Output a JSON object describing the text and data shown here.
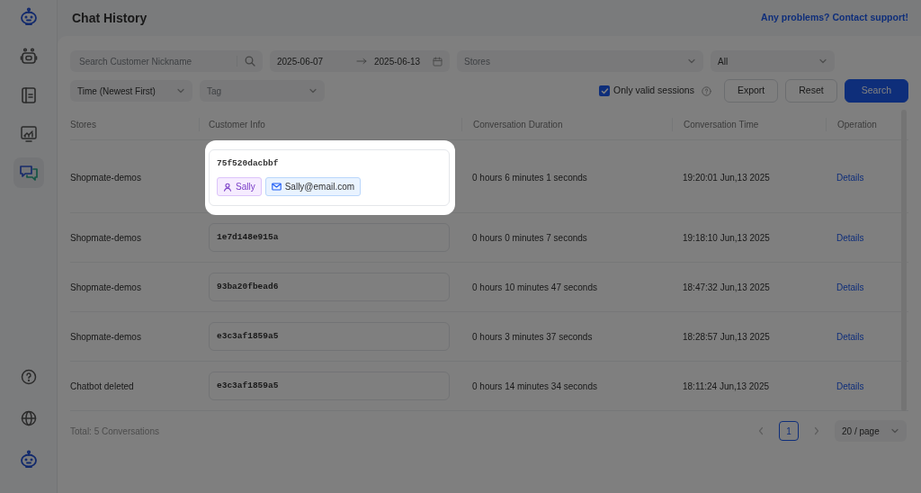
{
  "sidebar": {
    "items": [
      {
        "selected": false
      },
      {
        "selected": false
      },
      {
        "selected": false
      },
      {
        "selected": true
      }
    ]
  },
  "header": {
    "title": "Chat History",
    "support_link": "Any problems? Contact support!"
  },
  "filters": {
    "search": {
      "placeholder": "Search Customer Nickname"
    },
    "date_from": "2025-06-07",
    "date_to": "2025-06-13",
    "stores": {
      "placeholder": "Stores"
    },
    "status": {
      "value": "All"
    },
    "sort": {
      "value": "Time (Newest First)"
    },
    "tag": {
      "placeholder": "Tag"
    },
    "only_valid_sessions": {
      "label": "Only valid sessions",
      "checked": true
    },
    "buttons": [
      {
        "label": "Export",
        "kind": "default"
      },
      {
        "label": "Reset",
        "kind": "default"
      },
      {
        "label": "Search",
        "kind": "primary"
      }
    ]
  },
  "table": {
    "columns": [
      "Stores",
      "Customer Info",
      "Conversation Duration",
      "Conversation Time",
      "Operation"
    ],
    "rows": [
      {
        "store": "Shopmate-demos",
        "customer_id": "75f520dacbbf",
        "highlighted": true,
        "tags": [
          {
            "kind": "name",
            "text": "Sally"
          },
          {
            "kind": "email",
            "text": "Sally@email.com"
          }
        ],
        "duration": "0 hours 6 minutes 1 seconds",
        "time": "19:20:01 Jun,13 2025",
        "action": "Details"
      },
      {
        "store": "Shopmate-demos",
        "customer_id": "1e7d148e915a",
        "highlighted": false,
        "duration": "0 hours 0 minutes 7 seconds",
        "time": "19:18:10 Jun,13 2025",
        "action": "Details"
      },
      {
        "store": "Shopmate-demos",
        "customer_id": "93ba20fbead6",
        "highlighted": false,
        "duration": "0 hours 10 minutes 47 seconds",
        "time": "18:47:32 Jun,13 2025",
        "action": "Details"
      },
      {
        "store": "Shopmate-demos",
        "customer_id": "e3c3af1859a5",
        "highlighted": false,
        "duration": "0 hours 3 minutes 37 seconds",
        "time": "18:28:57 Jun,13 2025",
        "action": "Details"
      },
      {
        "store": "Chatbot deleted",
        "customer_id": "e3c3af1859a5",
        "highlighted": false,
        "duration": "0 hours 14 minutes 34 seconds",
        "time": "18:11:24 Jun,13 2025",
        "action": "Details"
      }
    ]
  },
  "footer": {
    "total": "Total: 5 Conversations",
    "pages": [
      {
        "label": "1",
        "selected": true
      }
    ],
    "page_size": "20 / page"
  }
}
